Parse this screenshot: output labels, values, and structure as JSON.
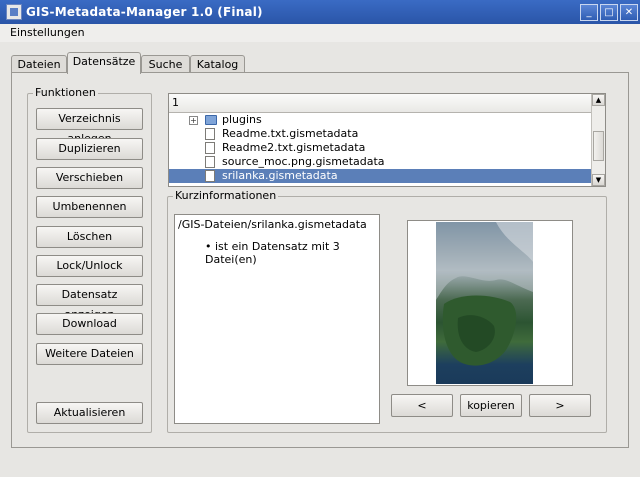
{
  "window": {
    "title": "GIS-Metadata-Manager 1.0 (Final)"
  },
  "menubar": {
    "einstellungen": "Einstellungen"
  },
  "tabs": [
    "Dateien",
    "Datensätze",
    "Suche",
    "Katalog"
  ],
  "funktionen": {
    "title": "Funktionen",
    "buttons": [
      "Verzeichnis anlegen",
      "Duplizieren",
      "Verschieben",
      "Umbenennen",
      "Löschen",
      "Lock/Unlock",
      "Datensatz anzeigen",
      "Download",
      "Weitere Dateien"
    ],
    "refresh": "Aktualisieren"
  },
  "tree": {
    "header": "1",
    "rows": [
      {
        "label": "plugins",
        "type": "folder"
      },
      {
        "label": "Readme.txt.gismetadata",
        "type": "file"
      },
      {
        "label": "Readme2.txt.gismetadata",
        "type": "file"
      },
      {
        "label": "source_moc.png.gismetadata",
        "type": "file"
      },
      {
        "label": "srilanka.gismetadata",
        "type": "file",
        "selected": true
      }
    ]
  },
  "kurz": {
    "title": "Kurzinformationen",
    "path": "/GIS-Dateien/srilanka.gismetadata",
    "bullet": "ist ein Datensatz mit 3 Datei(en)",
    "prev": "<",
    "copy": "kopieren",
    "next": ">"
  }
}
